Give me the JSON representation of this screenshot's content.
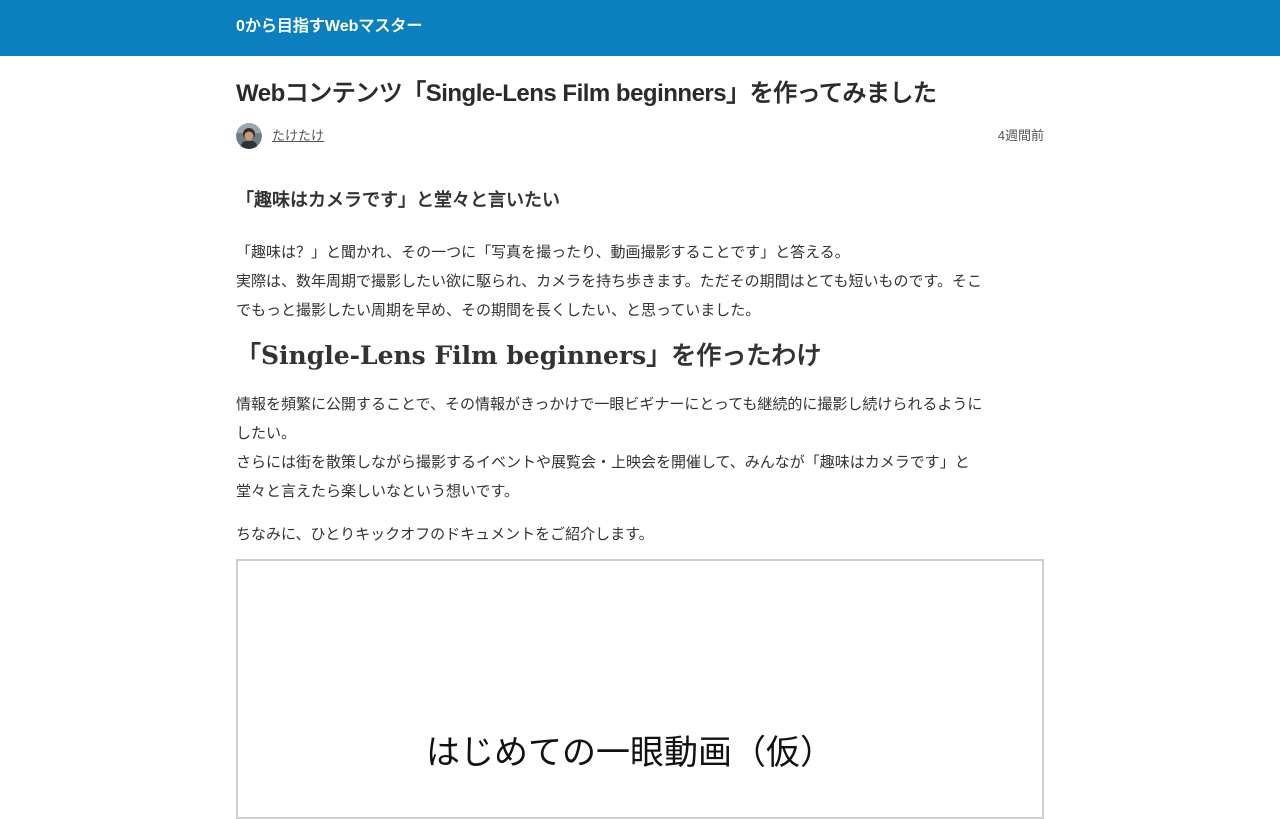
{
  "header": {
    "site_title": "0から目指すWebマスター",
    "background": "#0c7fbe"
  },
  "post": {
    "title": "Webコンテンツ「Single-Lens Film beginners」を作ってみました",
    "author": "たけたけ",
    "date": "4週間前"
  },
  "content": {
    "heading1": "「趣味はカメラです」と堂々と言いたい",
    "para1_lines": [
      "「趣味は？」と聞かれ、その一つに「写真を撮ったり、動画撮影することです」と答える。",
      "実際は、数年周期で撮影したい欲に駆られ、カメラを持ち歩きます。ただその期間はとても短いものです。そこ",
      "でもっと撮影したい周期を早め、その期間を長くしたい、と思っていました。"
    ],
    "heading2": "「Single-Lens Film beginners」を作ったわけ",
    "para2_lines": [
      "情報を頻繁に公開することで、その情報がきっかけで一眼ビギナーにとっても継続的に撮影し続けられるように",
      "したい。",
      "さらには街を散策しながら撮影するイベントや展覧会・上映会を開催して、みんなが「趣味はカメラです」と",
      "堂々と言えたら楽しいなという想いです。"
    ],
    "para3": "ちなみに、ひとりキックオフのドキュメントをご紹介します。",
    "image_text": "はじめての一眼動画（仮）"
  }
}
